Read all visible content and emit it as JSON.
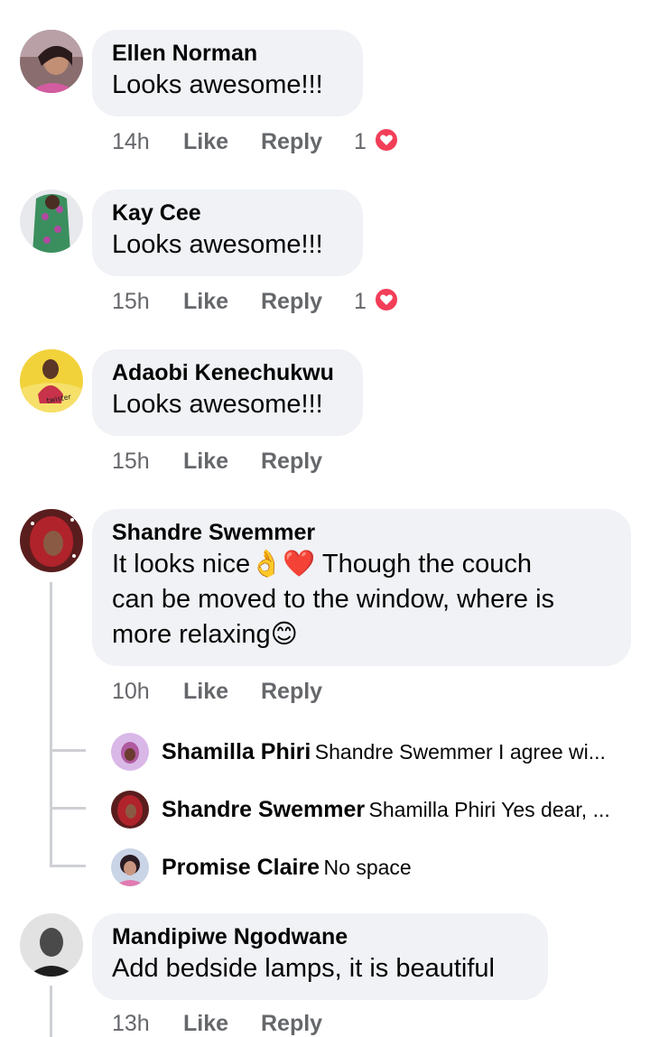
{
  "comments": [
    {
      "author": "Ellen Norman",
      "text": "Looks awesome!!!",
      "time": "14h",
      "like": "Like",
      "reply": "Reply",
      "reactions": "1",
      "reaction_icon": "heart-icon"
    },
    {
      "author": "Kay Cee",
      "text": "Looks awesome!!!",
      "time": "15h",
      "like": "Like",
      "reply": "Reply",
      "reactions": "1",
      "reaction_icon": "heart-icon"
    },
    {
      "author": "Adaobi Kenechukwu",
      "text": "Looks awesome!!!",
      "time": "15h",
      "like": "Like",
      "reply": "Reply"
    },
    {
      "author": "Shandre Swemmer",
      "text_lines": [
        "It looks nice👌❤️ Though the couch",
        "can be moved to the window, where is",
        "more relaxing😊"
      ],
      "time": "10h",
      "like": "Like",
      "reply": "Reply",
      "replies": [
        {
          "author": "Shamilla Phiri",
          "text": "Shandre Swemmer I agree wi..."
        },
        {
          "author": "Shandre Swemmer",
          "text": "Shamilla Phiri Yes dear, ..."
        },
        {
          "author": "Promise Claire",
          "text": "No space"
        }
      ]
    },
    {
      "author": "Mandipiwe Ngodwane",
      "text": "Add bedside lamps, it is beautiful",
      "time": "13h",
      "like": "Like",
      "reply": "Reply"
    }
  ],
  "colors": {
    "bubble": "#f0f2f5",
    "meta": "#65676b",
    "reaction": "#f33e58",
    "thread": "#ced0d4"
  }
}
